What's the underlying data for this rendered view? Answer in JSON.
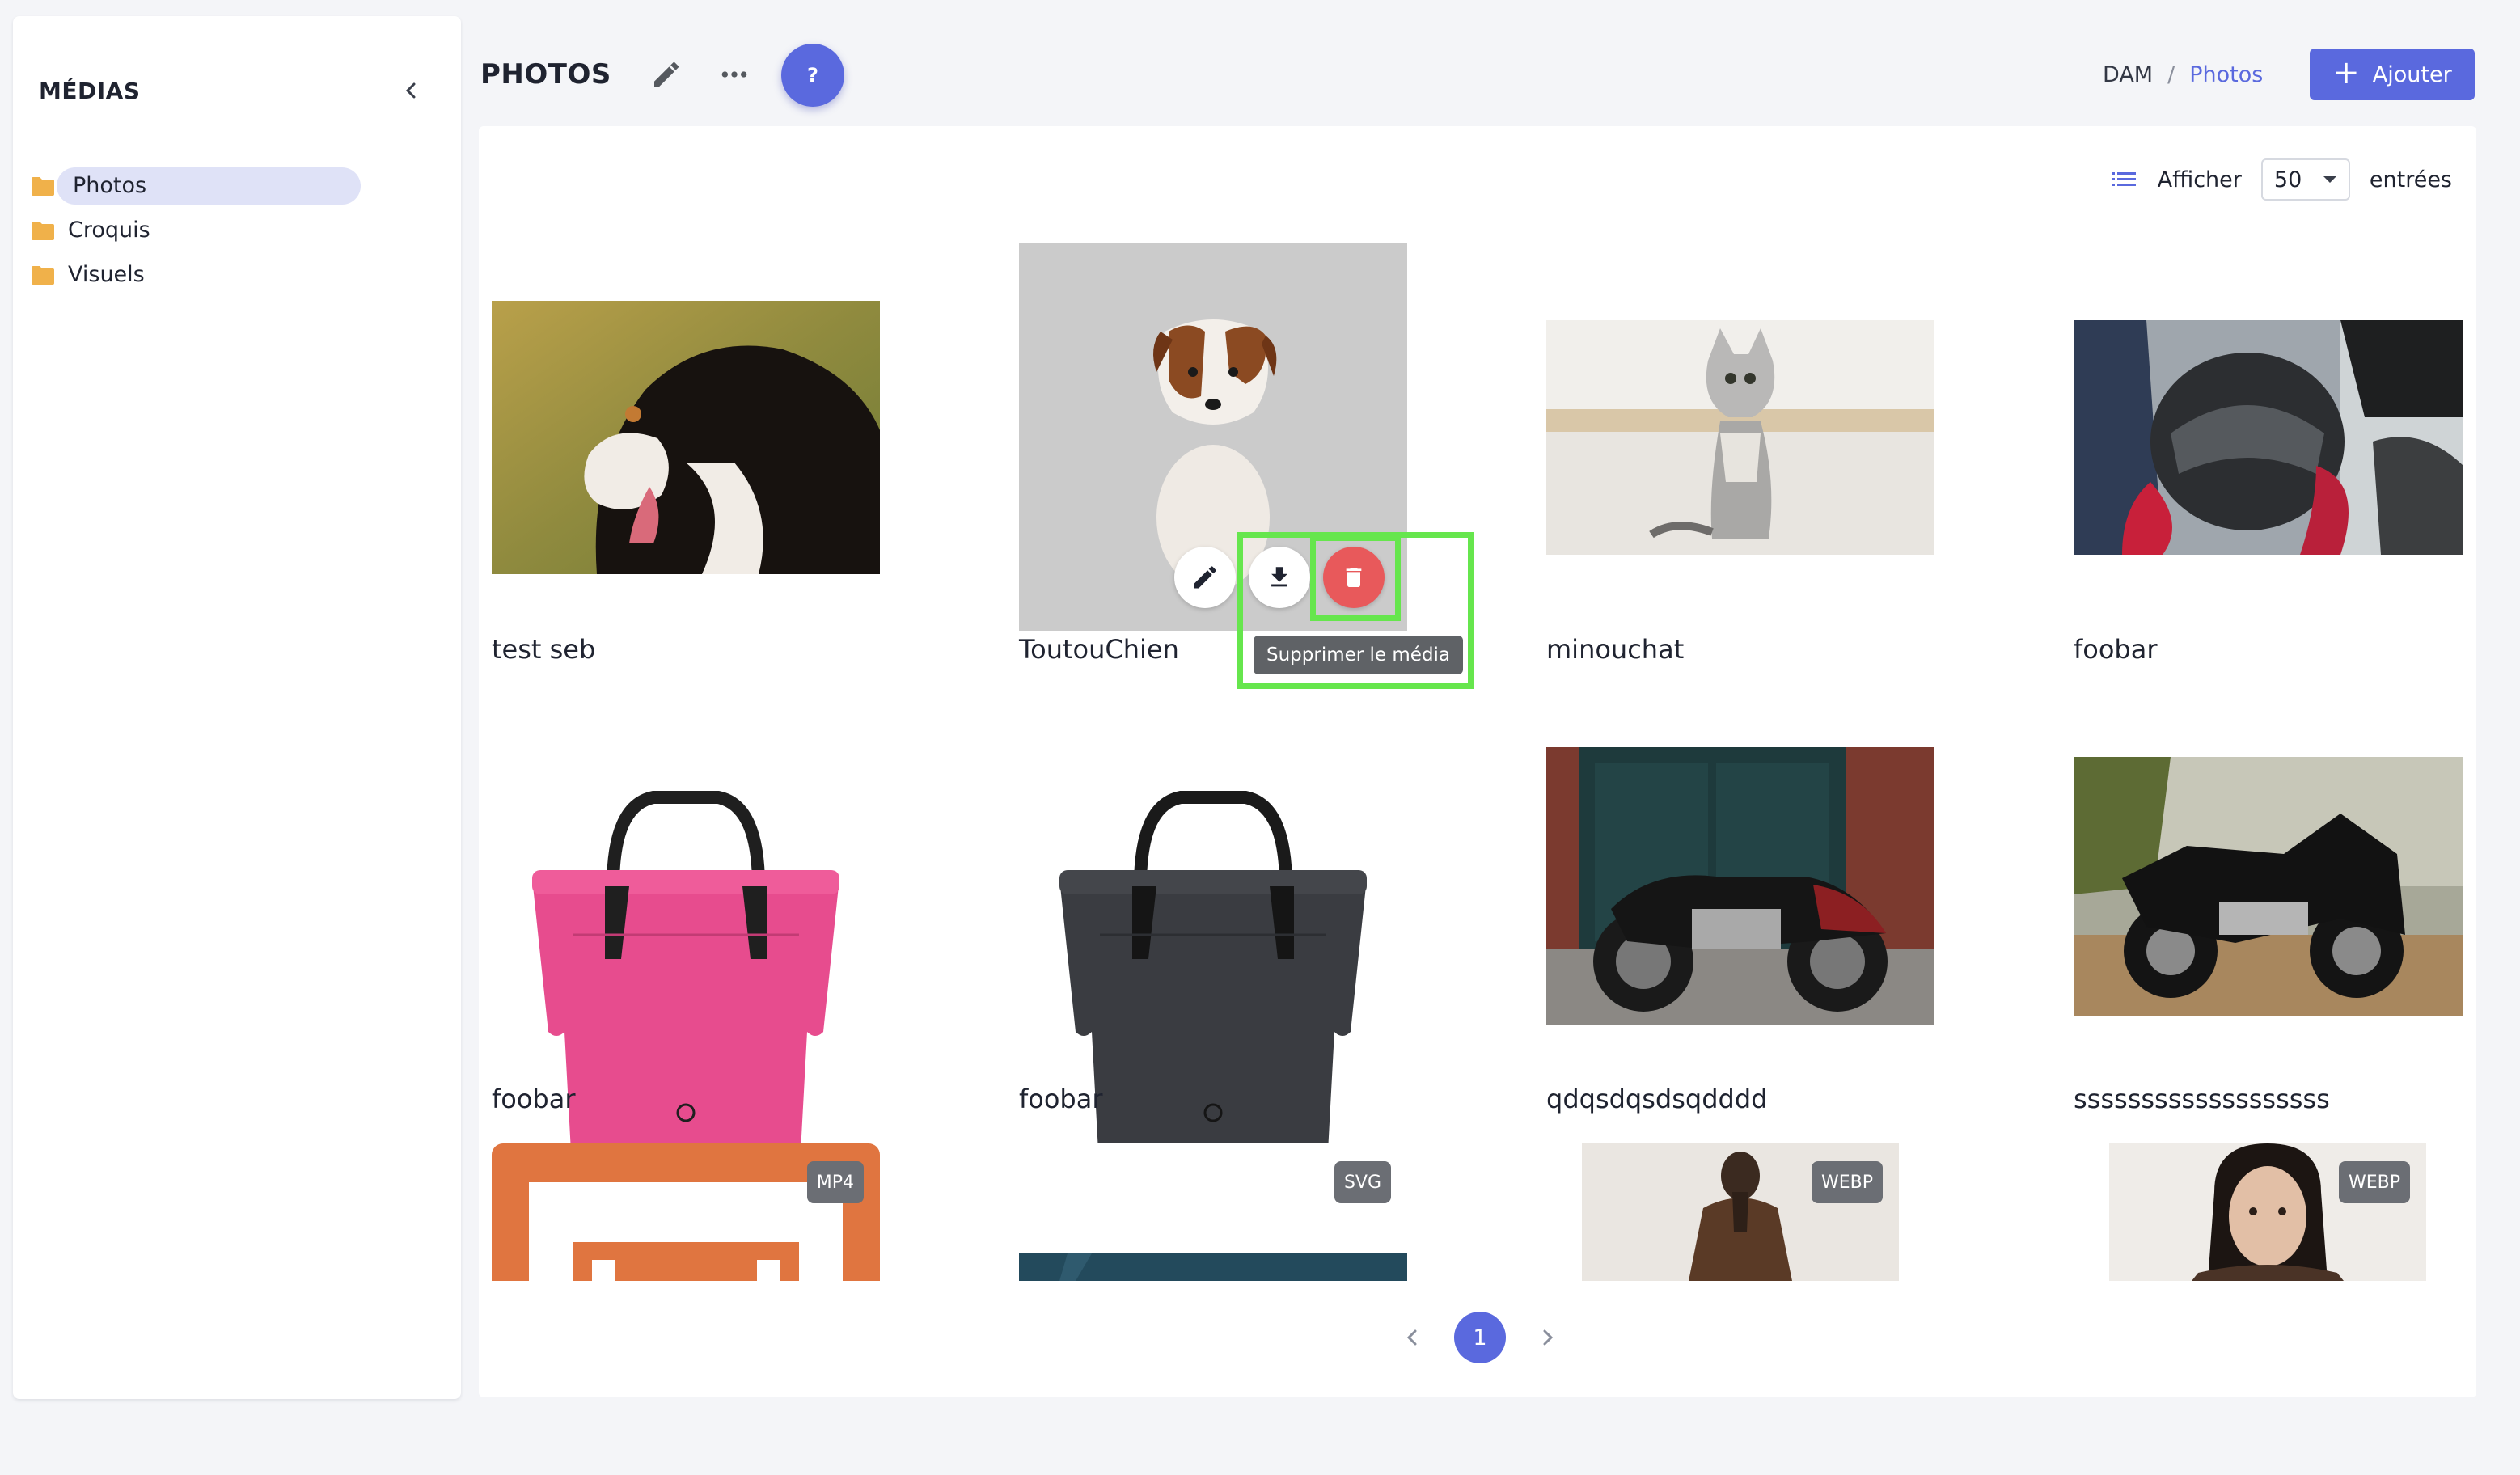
{
  "sidebar": {
    "title": "MÉDIAS",
    "folders": [
      {
        "label": "Photos",
        "active": true
      },
      {
        "label": "Croquis",
        "active": false
      },
      {
        "label": "Visuels",
        "active": false
      }
    ]
  },
  "header": {
    "title": "PHOTOS",
    "help_label": "?",
    "breadcrumb": {
      "root": "DAM",
      "separator": "/",
      "current": "Photos"
    },
    "add_button_label": "Ajouter"
  },
  "toolbar": {
    "show_label": "Afficher",
    "page_size": "50",
    "entries_label": "entrées"
  },
  "media": [
    {
      "label": "test seb",
      "image": "bernese-mountain-dog"
    },
    {
      "label": "ToutouChien",
      "image": "jack-russell-puppy"
    },
    {
      "label": "minouchat",
      "image": "tabby-kitten"
    },
    {
      "label": "foobar",
      "image": "motorcycle-helmet"
    },
    {
      "label": "foobar",
      "image": "pink-travel-bag"
    },
    {
      "label": "foobar",
      "image": "black-travel-bag"
    },
    {
      "label": "qdqsdqsdsqdddd",
      "image": "red-black-motorcycle"
    },
    {
      "label": "sssssssssssssssssss",
      "image": "touring-motorcycle"
    },
    {
      "label": "",
      "image": "orange-video-frame",
      "badge": "MP4"
    },
    {
      "label": "",
      "image": "dark-teal-graphic",
      "badge": "SVG"
    },
    {
      "label": "",
      "image": "woman-leather-jacket",
      "badge": "WEBP"
    },
    {
      "label": "",
      "image": "woman-portrait",
      "badge": "WEBP"
    }
  ],
  "hover_actions": {
    "tooltip": "Supprimer le média",
    "buttons": [
      "edit-icon",
      "download-icon",
      "trash-icon"
    ]
  },
  "pagination": {
    "current_page": "1"
  },
  "colors": {
    "accent": "#5a69de",
    "delete": "#e8595b",
    "highlight": "#66e64d",
    "folder": "#f0b14a"
  }
}
